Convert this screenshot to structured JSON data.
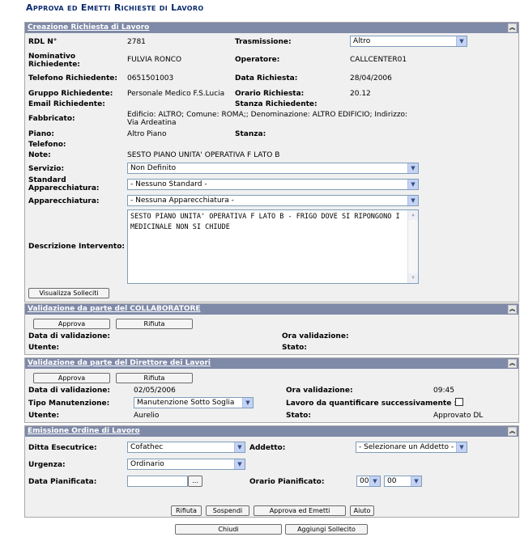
{
  "page": {
    "title": "Approva ed Emetti Richieste di Lavoro"
  },
  "creazione": {
    "header": "Creazione Richiesta di Lavoro",
    "rdl_label": "RDL N°",
    "rdl_value": "2781",
    "trasmissione_label": "Trasmissione:",
    "trasmissione_value": "Altro",
    "nominativo_label": "Nominativo Richiedente:",
    "nominativo_value": "FULVIA RONCO",
    "operatore_label": "Operatore:",
    "operatore_value": "CALLCENTER01",
    "telefono_rich_label": "Telefono Richiedente:",
    "telefono_rich_value": "0651501003",
    "data_rich_label": "Data Richiesta:",
    "data_rich_value": "28/04/2006",
    "gruppo_label": "Gruppo Richiedente:",
    "gruppo_value": "Personale Medico F.S.Lucia",
    "orario_label": "Orario Richiesta:",
    "orario_value": "20.12",
    "email_label": "Email Richiedente:",
    "stanza_rich_label": "Stanza Richiedente:",
    "fabbricato_label": "Fabbricato:",
    "fabbricato_value": "Edificio: ALTRO; Comune: ROMA;; Denominazione: ALTRO EDIFICIO; Indirizzo: Via Ardeatina",
    "piano_label": "Piano:",
    "piano_value": "Altro Piano",
    "stanza_label": "Stanza:",
    "telefono_label": "Telefono:",
    "note_label": "Note:",
    "note_value": "SESTO PIANO UNITA' OPERATIVA F LATO B",
    "servizio_label": "Servizio:",
    "servizio_value": "Non Definito",
    "standard_label": "Standard Apparecchiatura:",
    "standard_value": "- Nessuno Standard -",
    "apparecchiatura_label": "Apparecchiatura:",
    "apparecchiatura_value": "- Nessuna Apparecchiatura -",
    "descrizione_label": "Descrizione Intervento:",
    "descrizione_value": "SESTO PIANO UNITA' OPERATIVA F LATO B - FRIGO DOVE SI RIPONGONO I MEDICINALE NON SI CHIUDE",
    "visualizza_btn": "Visualizza Solleciti"
  },
  "collaboratore": {
    "header": "Validazione da parte del COLLABORATORE",
    "approva_btn": "Approva",
    "rifiuta_btn": "Rifiuta",
    "data_label": "Data di validazione:",
    "ora_label": "Ora validazione:",
    "utente_label": "Utente:",
    "stato_label": "Stato:"
  },
  "direttore": {
    "header": "Validazione da parte del Direttore dei Lavori",
    "approva_btn": "Approva",
    "rifiuta_btn": "Rifiuta",
    "data_label": "Data di validazione:",
    "data_value": "02/05/2006",
    "ora_label": "Ora validazione:",
    "ora_value": "09:45",
    "tipo_label": "Tipo Manutenzione:",
    "tipo_value": "Manutenzione Sotto Soglia",
    "lavoro_label": "Lavoro da quantificare successivamente :",
    "lavoro_checked": false,
    "utente_label": "Utente:",
    "utente_value": "Aurelio",
    "stato_label": "Stato:",
    "stato_value": "Approvato DL"
  },
  "emissione": {
    "header": "Emissione Ordine di Lavoro",
    "ditta_label": "Ditta Esecutrice:",
    "ditta_value": "Cofathec",
    "addetto_label": "Addetto:",
    "addetto_value": "- Selezionare un Addetto -",
    "urgenza_label": "Urgenza:",
    "urgenza_value": "Ordinario",
    "data_pian_label": "Data Pianificata:",
    "data_pian_value": "",
    "calendar_btn": "...",
    "orario_pian_label": "Orario Pianificato:",
    "ora_value": "00",
    "minuti_value": "00",
    "rifiuta_btn": "Rifiuta",
    "sospendi_btn": "Sospendi",
    "approva_emetti_btn": "Approva ed Emetti",
    "aiuto_btn": "Aiuto"
  },
  "footer": {
    "chiudi_btn": "Chiudi",
    "aggiungi_btn": "Aggiungi Sollecito"
  },
  "icons": {
    "collapse": "double-chevron-up-icon",
    "dropdown": "chevron-down-icon"
  },
  "colors": {
    "header_bg": "#7f8aa8",
    "panel_bg": "#f0f0f0",
    "title": "#0a2a6e"
  }
}
